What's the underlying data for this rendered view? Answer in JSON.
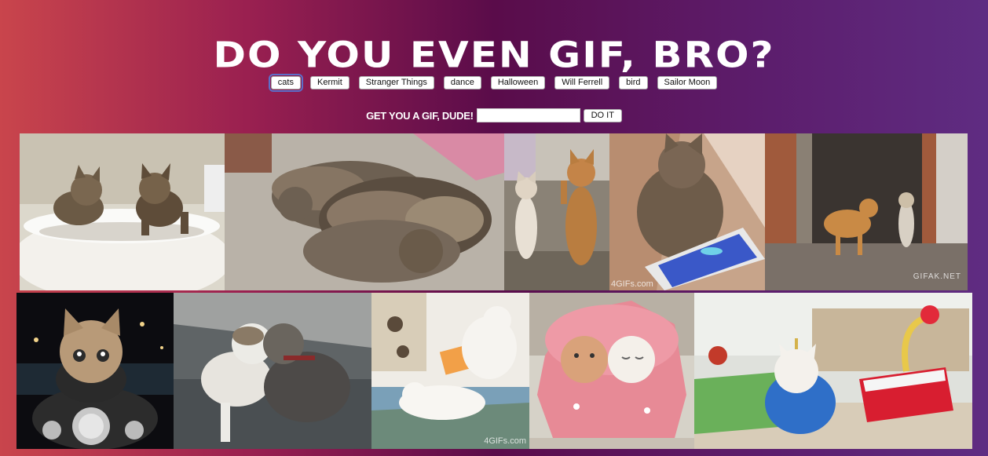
{
  "title": "DO YOU EVEN GIF, BRO?",
  "topic_buttons": [
    "cats",
    "Kermit",
    "Stranger Things",
    "dance",
    "Halloween",
    "Will Ferrell",
    "bird",
    "Sailor Moon"
  ],
  "active_topic": "cats",
  "add_form": {
    "label": "GET YOU A GIF, DUDE!",
    "input_value": "",
    "submit_label": "DO IT"
  },
  "gifs": [
    {
      "alt": "two kittens peering over a toilet bowl",
      "watermark": ""
    },
    {
      "alt": "cats sleeping in a pile on a rug",
      "watermark": ""
    },
    {
      "alt": "two kittens standing on hind legs",
      "watermark": ""
    },
    {
      "alt": "kitten playing a fish game on a phone",
      "watermark": "4GIFs.com"
    },
    {
      "alt": "cat walking through a doorway",
      "watermark": "GIFAK.NET"
    },
    {
      "alt": "kitten riding a motorcycle at night",
      "watermark": ""
    },
    {
      "alt": "two cats rubbing heads on a roof",
      "watermark": ""
    },
    {
      "alt": "white cats playing on a blanket",
      "watermark": "4GIFs.com"
    },
    {
      "alt": "two cats wrapped in a pink hoodie",
      "watermark": ""
    },
    {
      "alt": "white cat playing a toy keyboard",
      "watermark": ""
    }
  ]
}
